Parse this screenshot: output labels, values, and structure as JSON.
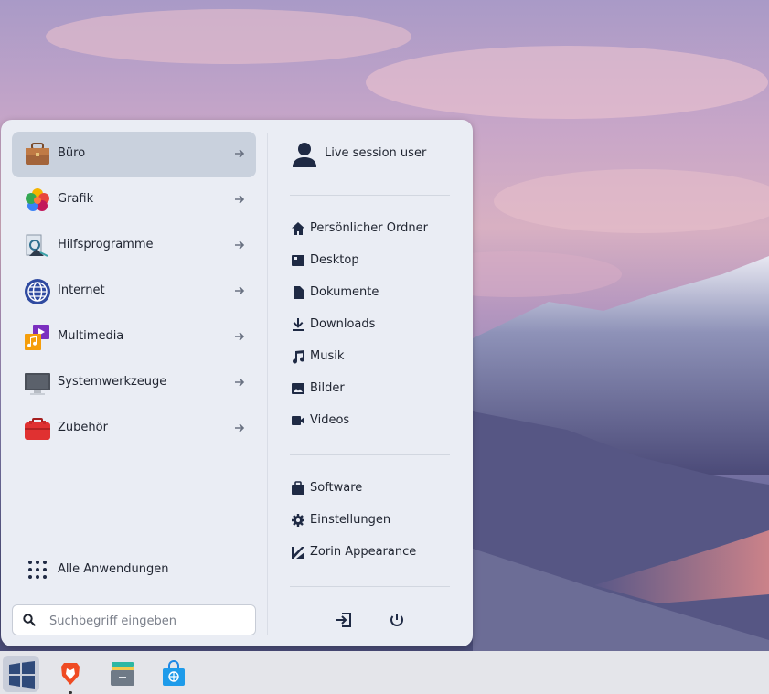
{
  "categories": [
    {
      "label": "Büro",
      "icon": "briefcase-icon",
      "active": true
    },
    {
      "label": "Grafik",
      "icon": "graphics-icon",
      "active": false
    },
    {
      "label": "Hilfsprogramme",
      "icon": "utilities-icon",
      "active": false
    },
    {
      "label": "Internet",
      "icon": "globe-icon",
      "active": false
    },
    {
      "label": "Multimedia",
      "icon": "multimedia-icon",
      "active": false
    },
    {
      "label": "Systemwerkzeuge",
      "icon": "monitor-icon",
      "active": false
    },
    {
      "label": "Zubehör",
      "icon": "toolbox-icon",
      "active": false
    }
  ],
  "all_apps_label": "Alle Anwendungen",
  "search": {
    "placeholder": "Suchbegriff eingeben",
    "value": ""
  },
  "user": {
    "name": "Live session user"
  },
  "places": [
    {
      "label": "Persönlicher Ordner",
      "icon": "home-icon"
    },
    {
      "label": "Desktop",
      "icon": "desktop-icon"
    },
    {
      "label": "Dokumente",
      "icon": "document-icon"
    },
    {
      "label": "Downloads",
      "icon": "download-icon"
    },
    {
      "label": "Musik",
      "icon": "music-icon"
    },
    {
      "label": "Bilder",
      "icon": "image-icon"
    },
    {
      "label": "Videos",
      "icon": "video-icon"
    }
  ],
  "system": [
    {
      "label": "Software",
      "icon": "software-bag-icon"
    },
    {
      "label": "Einstellungen",
      "icon": "settings-gear-icon"
    },
    {
      "label": "Zorin Appearance",
      "icon": "appearance-icon"
    }
  ],
  "taskbar": [
    {
      "name": "zorin-menu",
      "active": true
    },
    {
      "name": "brave-browser",
      "active": false,
      "running": true
    },
    {
      "name": "files",
      "active": false
    },
    {
      "name": "software-store",
      "active": false
    }
  ],
  "colors": {
    "menu_bg": "#eaedf4",
    "active_item": "#c9d1dd",
    "icon_dark": "#1f2a44"
  }
}
